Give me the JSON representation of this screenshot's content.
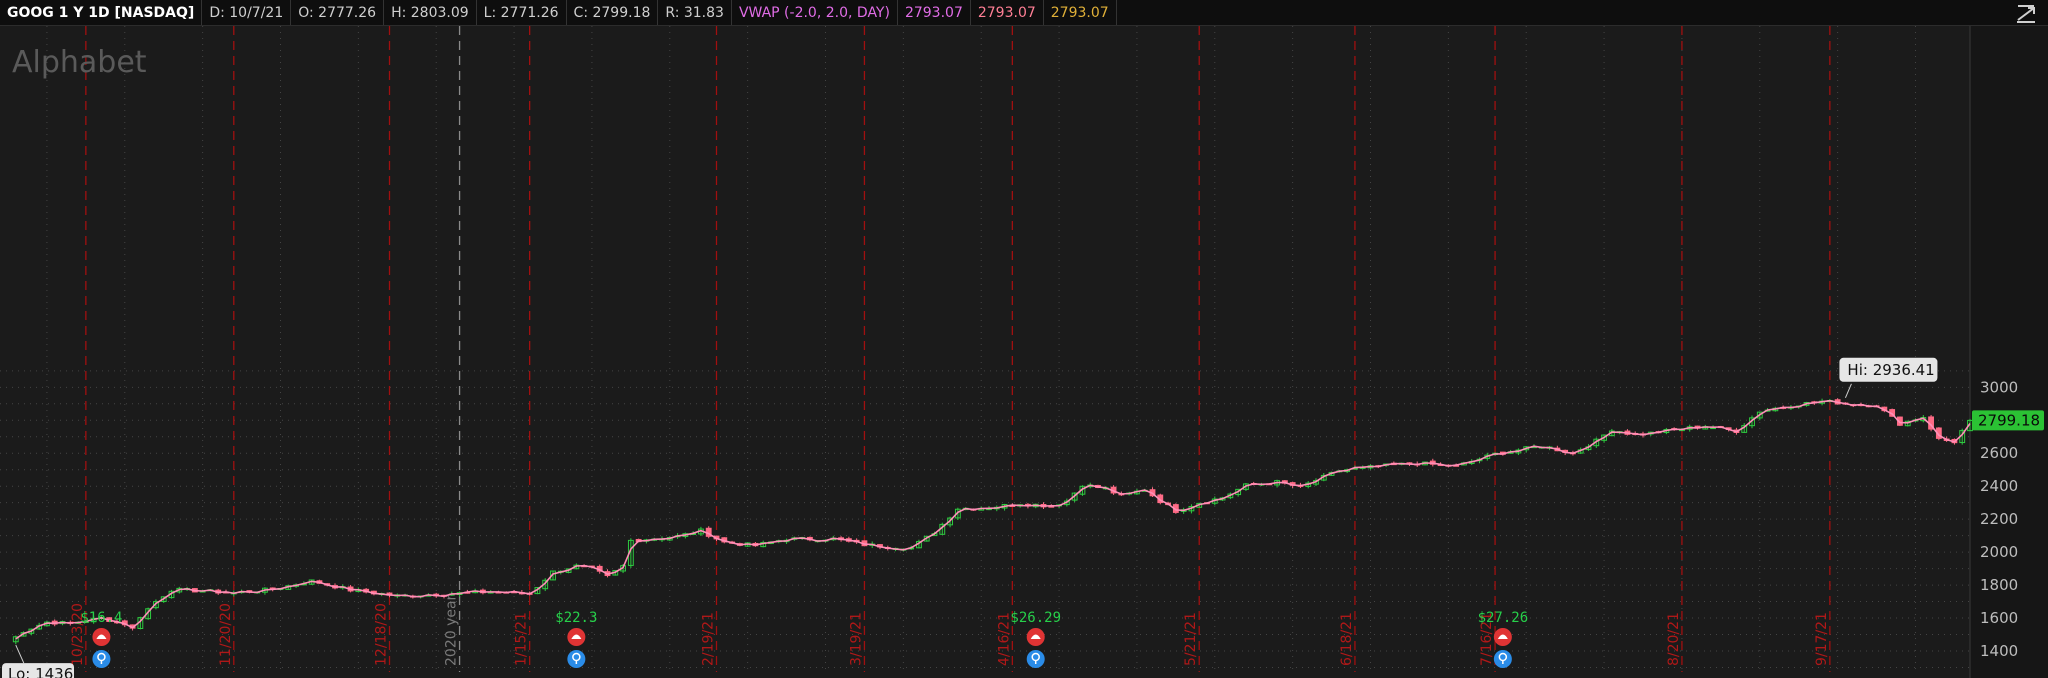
{
  "header": {
    "symbol": "GOOG 1 Y 1D [NASDAQ]",
    "date": "D: 10/7/21",
    "open": "O: 2777.26",
    "high": "H: 2803.09",
    "low": "L: 2771.26",
    "close": "C: 2799.18",
    "range": "R: 31.83",
    "vwap_label": "VWAP (-2.0, 2.0, DAY)",
    "vwap_values": [
      "2793.07",
      "2793.07",
      "2793.07"
    ]
  },
  "watermark": "Alphabet",
  "colors": {
    "background": "#1b1b1b",
    "header": "#0e0e0e",
    "up": "#2ecc40",
    "down": "#ff6b86",
    "vwap": "#ff8fb8",
    "period_line": "#a01010",
    "current_price_bg": "#2bc234",
    "dividend_text": "#27d04a",
    "earnings_icon": "#e03434",
    "info_icon": "#2a8ce8"
  },
  "icons": {
    "header_right": "chart-style-icon",
    "earnings": "phone-icon",
    "info": "lightbulb-icon"
  },
  "chart_data": {
    "type": "candlestick",
    "title": "GOOG 1 Y 1D [NASDAQ]",
    "ylim": [
      1300,
      3100
    ],
    "y_ticks": [
      1400,
      1600,
      1800,
      2000,
      2200,
      2400,
      2600,
      2800,
      3000
    ],
    "grid": true,
    "trading_days": 252,
    "year_marker": {
      "label": "2020 year",
      "day": 58
    },
    "period_markers": [
      {
        "label": "10/23/20",
        "day": 10
      },
      {
        "label": "11/20/20",
        "day": 29
      },
      {
        "label": "12/18/20",
        "day": 49
      },
      {
        "label": "1/15/21",
        "day": 67
      },
      {
        "label": "2/19/21",
        "day": 91
      },
      {
        "label": "3/19/21",
        "day": 110
      },
      {
        "label": "4/16/21",
        "day": 129
      },
      {
        "label": "5/21/21",
        "day": 153
      },
      {
        "label": "6/18/21",
        "day": 173
      },
      {
        "label": "7/16/21",
        "day": 191
      },
      {
        "label": "8/20/21",
        "day": 215
      },
      {
        "label": "9/17/21",
        "day": 234
      }
    ],
    "close_anchors": [
      {
        "day": 0,
        "close": 1450
      },
      {
        "day": 2,
        "close": 1520
      },
      {
        "day": 5,
        "close": 1575
      },
      {
        "day": 8,
        "close": 1568
      },
      {
        "day": 12,
        "close": 1600
      },
      {
        "day": 15,
        "close": 1565
      },
      {
        "day": 16,
        "close": 1535
      },
      {
        "day": 17,
        "close": 1610
      },
      {
        "day": 19,
        "close": 1700
      },
      {
        "day": 21,
        "close": 1772
      },
      {
        "day": 25,
        "close": 1765
      },
      {
        "day": 29,
        "close": 1752
      },
      {
        "day": 34,
        "close": 1775
      },
      {
        "day": 39,
        "close": 1825
      },
      {
        "day": 44,
        "close": 1770
      },
      {
        "day": 50,
        "close": 1735
      },
      {
        "day": 56,
        "close": 1745
      },
      {
        "day": 62,
        "close": 1760
      },
      {
        "day": 67,
        "close": 1745
      },
      {
        "day": 70,
        "close": 1880
      },
      {
        "day": 73,
        "close": 1915
      },
      {
        "day": 75,
        "close": 1900
      },
      {
        "day": 77,
        "close": 1850
      },
      {
        "day": 79,
        "close": 1915
      },
      {
        "day": 80,
        "close": 2070
      },
      {
        "day": 86,
        "close": 2095
      },
      {
        "day": 89,
        "close": 2130
      },
      {
        "day": 92,
        "close": 2060
      },
      {
        "day": 96,
        "close": 2040
      },
      {
        "day": 100,
        "close": 2080
      },
      {
        "day": 106,
        "close": 2080
      },
      {
        "day": 110,
        "close": 2045
      },
      {
        "day": 116,
        "close": 2025
      },
      {
        "day": 119,
        "close": 2120
      },
      {
        "day": 122,
        "close": 2265
      },
      {
        "day": 126,
        "close": 2270
      },
      {
        "day": 130,
        "close": 2295
      },
      {
        "day": 134,
        "close": 2280
      },
      {
        "day": 136,
        "close": 2310
      },
      {
        "day": 138,
        "close": 2410
      },
      {
        "day": 141,
        "close": 2385
      },
      {
        "day": 143,
        "close": 2340
      },
      {
        "day": 146,
        "close": 2380
      },
      {
        "day": 148,
        "close": 2310
      },
      {
        "day": 150,
        "close": 2250
      },
      {
        "day": 153,
        "close": 2300
      },
      {
        "day": 156,
        "close": 2330
      },
      {
        "day": 159,
        "close": 2405
      },
      {
        "day": 163,
        "close": 2425
      },
      {
        "day": 166,
        "close": 2395
      },
      {
        "day": 171,
        "close": 2495
      },
      {
        "day": 176,
        "close": 2520
      },
      {
        "day": 181,
        "close": 2540
      },
      {
        "day": 186,
        "close": 2520
      },
      {
        "day": 191,
        "close": 2595
      },
      {
        "day": 197,
        "close": 2645
      },
      {
        "day": 201,
        "close": 2600
      },
      {
        "day": 204,
        "close": 2675
      },
      {
        "day": 206,
        "close": 2745
      },
      {
        "day": 209,
        "close": 2710
      },
      {
        "day": 213,
        "close": 2735
      },
      {
        "day": 218,
        "close": 2765
      },
      {
        "day": 222,
        "close": 2735
      },
      {
        "day": 225,
        "close": 2855
      },
      {
        "day": 229,
        "close": 2890
      },
      {
        "day": 233,
        "close": 2915
      },
      {
        "day": 237,
        "close": 2900
      },
      {
        "day": 240,
        "close": 2890
      },
      {
        "day": 243,
        "close": 2780
      },
      {
        "day": 246,
        "close": 2820
      },
      {
        "day": 248,
        "close": 2685
      },
      {
        "day": 250,
        "close": 2670
      },
      {
        "day": 252,
        "close": 2799.18
      }
    ],
    "high_label": "Hi: 2936.41",
    "high": {
      "day": 236,
      "value": 2936.41
    },
    "low_label": "Lo: 1436",
    "low": {
      "day": 1,
      "value": 1436
    },
    "current_price": 2799.18,
    "current_price_label": "2799.18",
    "dividends": [
      {
        "label": "$16.4",
        "day": 12
      },
      {
        "label": "$22.3",
        "day": 73
      },
      {
        "label": "$26.29",
        "day": 132
      },
      {
        "label": "$27.26",
        "day": 192
      }
    ]
  }
}
